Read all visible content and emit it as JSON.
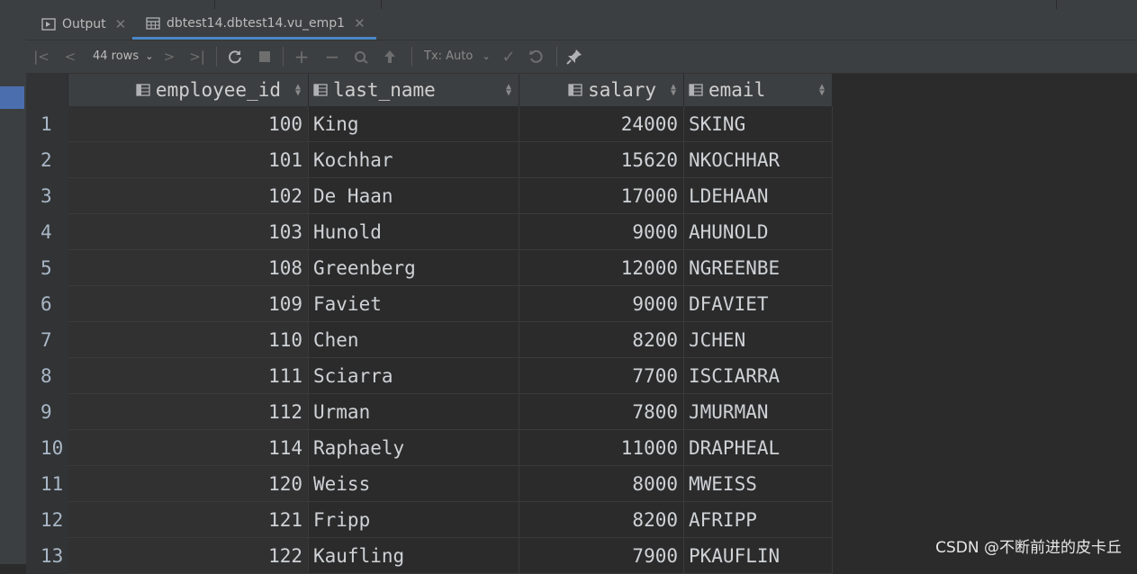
{
  "tabs": [
    {
      "label": "Output",
      "icon": "output-icon",
      "active": false
    },
    {
      "label": "dbtest14.dbtest14.vu_emp1",
      "icon": "table-icon",
      "active": true
    }
  ],
  "toolbar": {
    "rows_label": "44 rows",
    "tx_label": "Tx: Auto"
  },
  "columns": [
    "employee_id",
    "last_name",
    "salary",
    "email"
  ],
  "rows": [
    {
      "n": "1",
      "employee_id": "100",
      "last_name": "King",
      "salary": "24000",
      "email": "SKING"
    },
    {
      "n": "2",
      "employee_id": "101",
      "last_name": "Kochhar",
      "salary": "15620",
      "email": "NKOCHHAR"
    },
    {
      "n": "3",
      "employee_id": "102",
      "last_name": "De Haan",
      "salary": "17000",
      "email": "LDEHAAN"
    },
    {
      "n": "4",
      "employee_id": "103",
      "last_name": "Hunold",
      "salary": "9000",
      "email": "AHUNOLD"
    },
    {
      "n": "5",
      "employee_id": "108",
      "last_name": "Greenberg",
      "salary": "12000",
      "email": "NGREENBE"
    },
    {
      "n": "6",
      "employee_id": "109",
      "last_name": "Faviet",
      "salary": "9000",
      "email": "DFAVIET"
    },
    {
      "n": "7",
      "employee_id": "110",
      "last_name": "Chen",
      "salary": "8200",
      "email": "JCHEN"
    },
    {
      "n": "8",
      "employee_id": "111",
      "last_name": "Sciarra",
      "salary": "7700",
      "email": "ISCIARRA"
    },
    {
      "n": "9",
      "employee_id": "112",
      "last_name": "Urman",
      "salary": "7800",
      "email": "JMURMAN"
    },
    {
      "n": "10",
      "employee_id": "114",
      "last_name": "Raphaely",
      "salary": "11000",
      "email": "DRAPHEAL"
    },
    {
      "n": "11",
      "employee_id": "120",
      "last_name": "Weiss",
      "salary": "8000",
      "email": "MWEISS"
    },
    {
      "n": "12",
      "employee_id": "121",
      "last_name": "Fripp",
      "salary": "8200",
      "email": "AFRIPP"
    },
    {
      "n": "13",
      "employee_id": "122",
      "last_name": "Kaufling",
      "salary": "7900",
      "email": "PKAUFLIN"
    }
  ],
  "watermark": "CSDN @不断前进的皮卡丘",
  "colors": {
    "accent": "#4a88c7",
    "background": "#2b2b2b",
    "header": "#3c3f41"
  }
}
